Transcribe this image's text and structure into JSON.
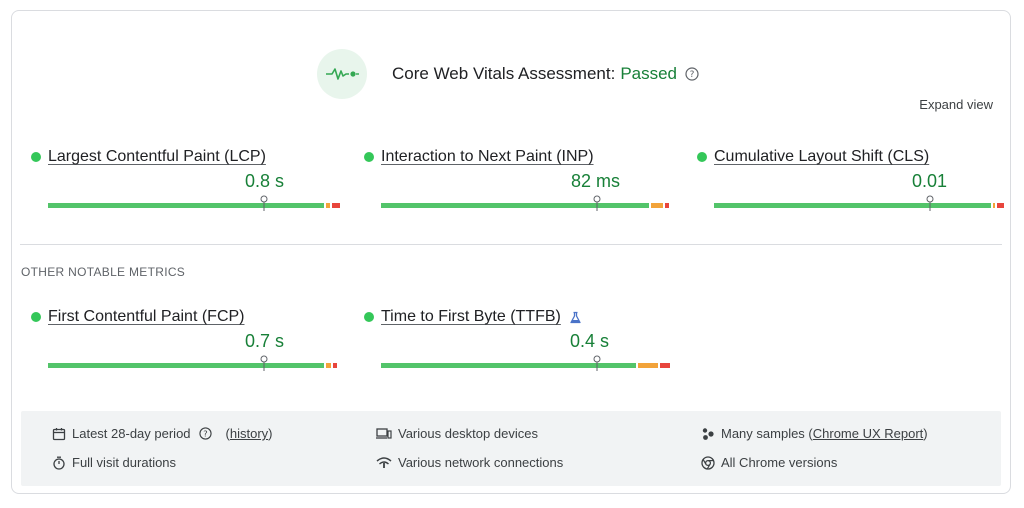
{
  "header": {
    "title": "Core Web Vitals Assessment:",
    "status": "Passed",
    "icon": "pulse-icon",
    "help_icon": "help-circle-icon"
  },
  "expand_view": "Expand view",
  "core_metrics": [
    {
      "name": "Largest Contentful Paint (LCP)",
      "value": "0.8 s",
      "rating": "good"
    },
    {
      "name": "Interaction to Next Paint (INP)",
      "value": "82 ms",
      "rating": "good"
    },
    {
      "name": "Cumulative Layout Shift (CLS)",
      "value": "0.01",
      "rating": "good"
    }
  ],
  "other_section_label": "OTHER NOTABLE METRICS",
  "other_metrics": [
    {
      "name": "First Contentful Paint (FCP)",
      "value": "0.7 s",
      "rating": "good"
    },
    {
      "name": "Time to First Byte (TTFB)",
      "value": "0.4 s",
      "rating": "good",
      "badge_icon": "experimental-flask-icon"
    }
  ],
  "footer": {
    "period": "Latest 28-day period",
    "history_open": "(",
    "history_link": "history",
    "history_close": ")",
    "visit": "Full visit durations",
    "devices": "Various desktop devices",
    "network": "Various network connections",
    "samples_prefix": "Many samples (",
    "samples_link": "Chrome UX Report",
    "samples_suffix": ")",
    "chrome": "All Chrome versions"
  },
  "colors": {
    "good": "#53c46a",
    "needs_improvement": "#f2a33a",
    "poor": "#e8453c",
    "pass_text": "#188038"
  }
}
